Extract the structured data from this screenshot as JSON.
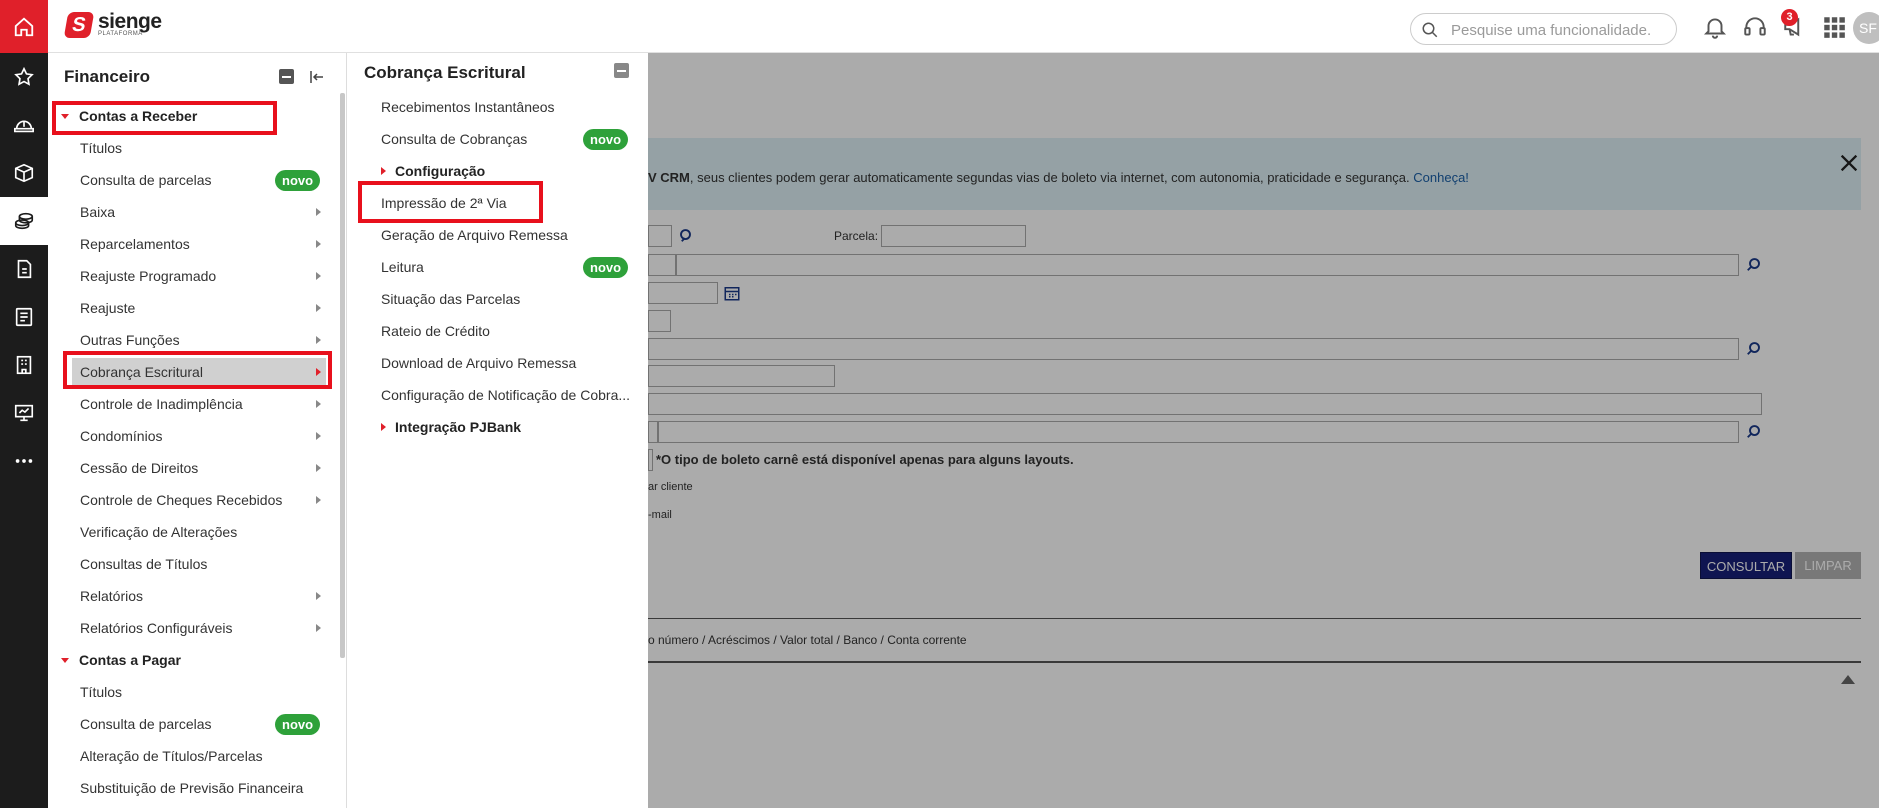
{
  "header": {
    "logo_name": "sienge",
    "logo_sub": "PLATAFORMA",
    "search_placeholder": "Pesquise uma funcionalidade.",
    "notification_count": "3",
    "avatar_initials": "SF"
  },
  "background": {
    "banner_text_pre": "V CRM",
    "banner_text_mid": ", seus clientes podem gerar automaticamente segundas vias de boleto via internet, com autonomia, praticidade e segurança. ",
    "banner_link": "Conheça!",
    "parcela_label": "Parcela:",
    "boleto_note": "*O tipo de boleto carnê está disponível apenas para alguns layouts.",
    "option_cliente": "ar cliente",
    "option_email": "-mail",
    "consultar_label": "CONSULTAR",
    "limpar_label": "LIMPAR",
    "columns_text": "o número / Acréscimos / Valor total / Banco / Conta corrente"
  },
  "panel1": {
    "title": "Financeiro",
    "items": [
      {
        "label": "Contas a Receber",
        "type": "section"
      },
      {
        "label": "Títulos"
      },
      {
        "label": "Consulta de parcelas",
        "badge": "novo"
      },
      {
        "label": "Baixa",
        "submenu": true
      },
      {
        "label": "Reparcelamentos",
        "submenu": true
      },
      {
        "label": "Reajuste Programado",
        "submenu": true
      },
      {
        "label": "Reajuste",
        "submenu": true
      },
      {
        "label": "Outras Funções",
        "submenu": true
      },
      {
        "label": "Cobrança Escritural",
        "submenu": true,
        "selected": true
      },
      {
        "label": "Controle de Inadimplência",
        "submenu": true
      },
      {
        "label": "Condomínios",
        "submenu": true
      },
      {
        "label": "Cessão de Direitos",
        "submenu": true
      },
      {
        "label": "Controle de Cheques Recebidos",
        "submenu": true
      },
      {
        "label": "Verificação de Alterações"
      },
      {
        "label": "Consultas de Títulos"
      },
      {
        "label": "Relatórios",
        "submenu": true
      },
      {
        "label": "Relatórios Configuráveis",
        "submenu": true
      },
      {
        "label": "Contas a Pagar",
        "type": "section"
      },
      {
        "label": "Títulos"
      },
      {
        "label": "Consulta de parcelas",
        "badge": "novo"
      },
      {
        "label": "Alteração de Títulos/Parcelas"
      },
      {
        "label": "Substituição de Previsão Financeira"
      }
    ]
  },
  "panel2": {
    "title": "Cobrança Escritural",
    "items": [
      {
        "label": "Recebimentos Instantâneos"
      },
      {
        "label": "Consulta de Cobranças",
        "badge": "novo"
      },
      {
        "label": "Configuração",
        "type": "section"
      },
      {
        "label": "Impressão de 2ª Via"
      },
      {
        "label": "Geração de Arquivo Remessa"
      },
      {
        "label": "Leitura",
        "badge": "novo"
      },
      {
        "label": "Situação das Parcelas"
      },
      {
        "label": "Rateio de Crédito"
      },
      {
        "label": "Download de Arquivo Remessa"
      },
      {
        "label": "Configuração de Notificação de Cobra..."
      },
      {
        "label": "Integração PJBank",
        "type": "section"
      }
    ]
  },
  "colors": {
    "brand_red": "#e0202a",
    "highlight_red": "#e8101c",
    "badge_green": "#2ea13a",
    "rail_dark": "#1c1c1c"
  }
}
